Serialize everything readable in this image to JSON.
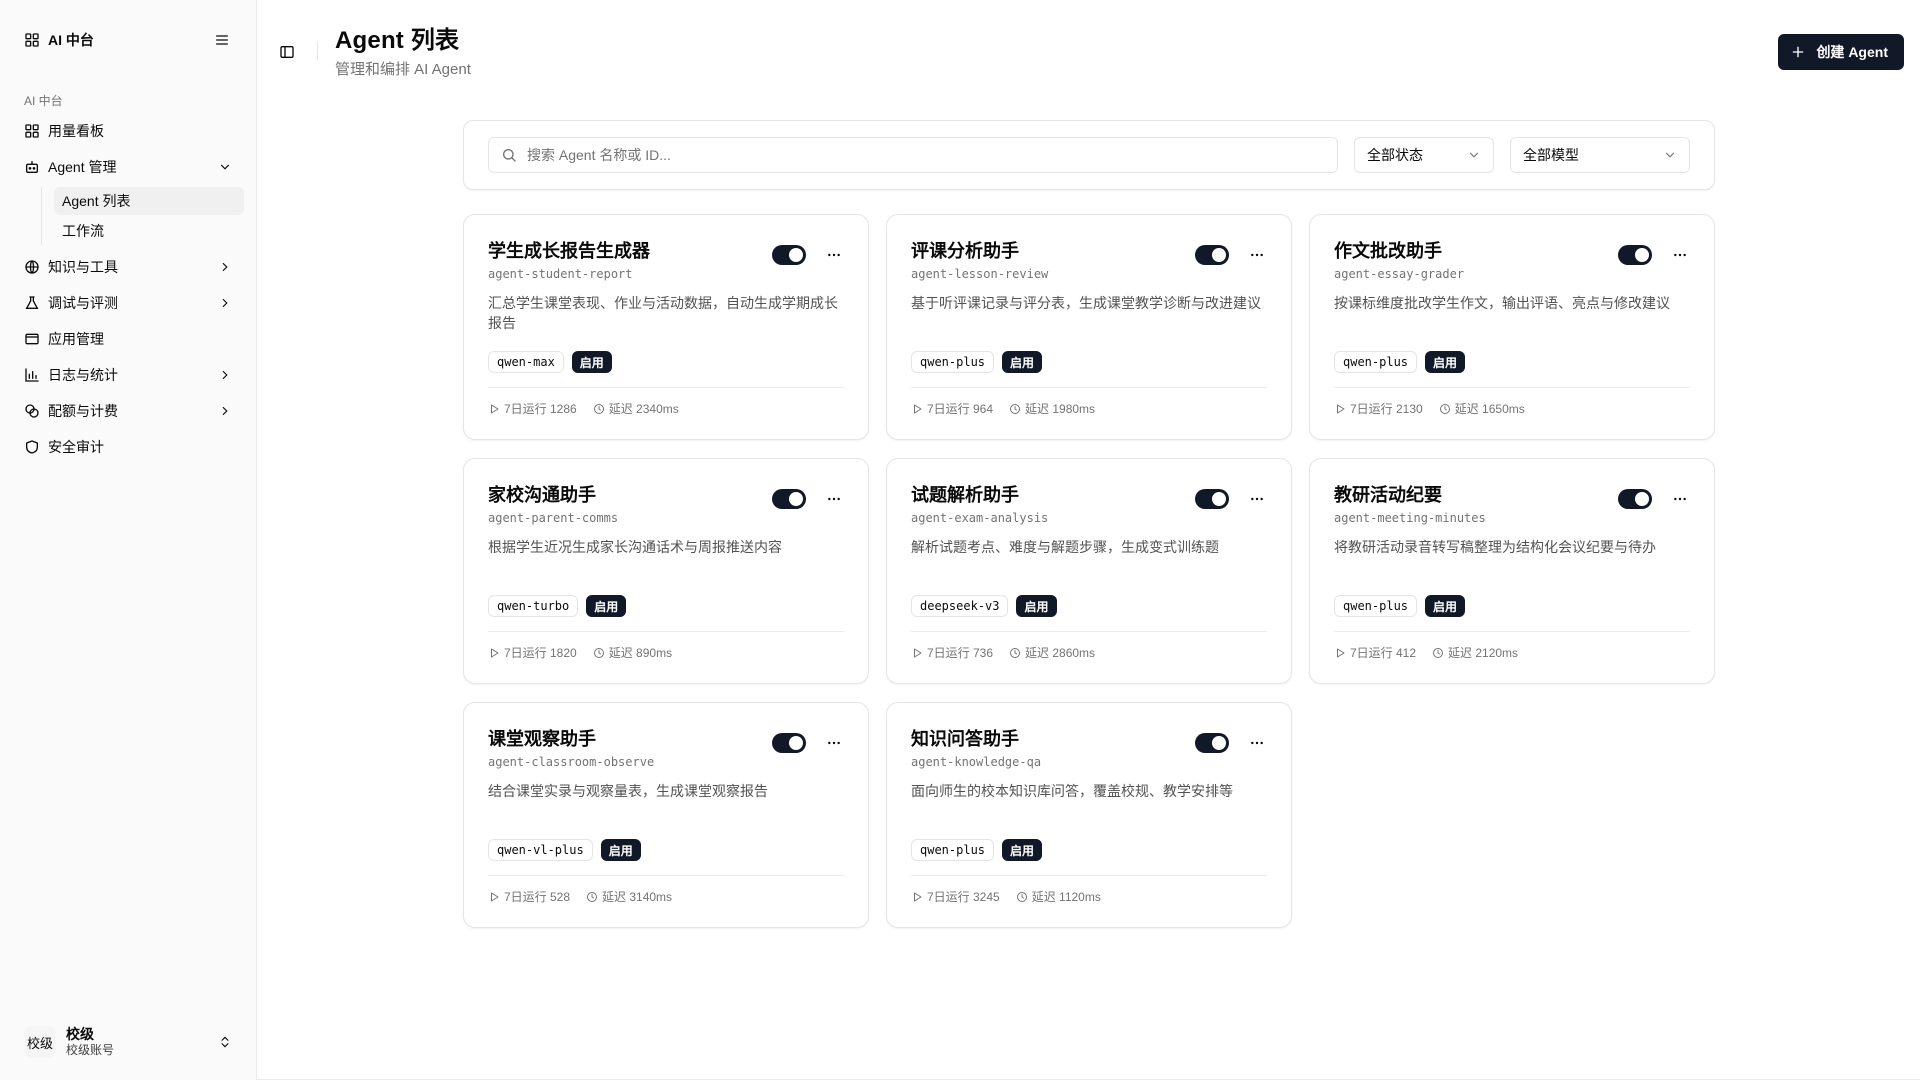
{
  "sidebar": {
    "brand": "AI 中台",
    "group_label": "AI 中台",
    "items": [
      {
        "label": "用量看板"
      },
      {
        "label": "Agent 管理"
      },
      {
        "label": "知识与工具"
      },
      {
        "label": "调试与评测"
      },
      {
        "label": "应用管理"
      },
      {
        "label": "日志与统计"
      },
      {
        "label": "配额与计费"
      },
      {
        "label": "安全审计"
      }
    ],
    "sub_items": [
      {
        "label": "Agent 列表"
      },
      {
        "label": "工作流"
      }
    ],
    "user": {
      "avatar": "校级",
      "name": "校级",
      "sub": "校级账号"
    }
  },
  "header": {
    "title": "Agent 列表",
    "subtitle": "管理和编排 AI Agent",
    "create_label": "创建 Agent"
  },
  "filters": {
    "search_placeholder": "搜索 Agent 名称或 ID...",
    "status": "全部状态",
    "model": "全部模型"
  },
  "agents": [
    {
      "name": "学生成长报告生成器",
      "id": "agent-student-report",
      "desc": "汇总学生课堂表现、作业与活动数据，自动生成学期成长报告",
      "model": "qwen-max",
      "status": "启用",
      "runs": "7日运行 1286",
      "latency": "延迟 2340ms"
    },
    {
      "name": "评课分析助手",
      "id": "agent-lesson-review",
      "desc": "基于听评课记录与评分表，生成课堂教学诊断与改进建议",
      "model": "qwen-plus",
      "status": "启用",
      "runs": "7日运行 964",
      "latency": "延迟 1980ms"
    },
    {
      "name": "作文批改助手",
      "id": "agent-essay-grader",
      "desc": "按课标维度批改学生作文，输出评语、亮点与修改建议",
      "model": "qwen-plus",
      "status": "启用",
      "runs": "7日运行 2130",
      "latency": "延迟 1650ms"
    },
    {
      "name": "家校沟通助手",
      "id": "agent-parent-comms",
      "desc": "根据学生近况生成家长沟通话术与周报推送内容",
      "model": "qwen-turbo",
      "status": "启用",
      "runs": "7日运行 1820",
      "latency": "延迟 890ms"
    },
    {
      "name": "试题解析助手",
      "id": "agent-exam-analysis",
      "desc": "解析试题考点、难度与解题步骤，生成变式训练题",
      "model": "deepseek-v3",
      "status": "启用",
      "runs": "7日运行 736",
      "latency": "延迟 2860ms"
    },
    {
      "name": "教研活动纪要",
      "id": "agent-meeting-minutes",
      "desc": "将教研活动录音转写稿整理为结构化会议纪要与待办",
      "model": "qwen-plus",
      "status": "启用",
      "runs": "7日运行 412",
      "latency": "延迟 2120ms"
    },
    {
      "name": "课堂观察助手",
      "id": "agent-classroom-observe",
      "desc": "结合课堂实录与观察量表，生成课堂观察报告",
      "model": "qwen-vl-plus",
      "status": "启用",
      "runs": "7日运行 528",
      "latency": "延迟 3140ms"
    },
    {
      "name": "知识问答助手",
      "id": "agent-knowledge-qa",
      "desc": "面向师生的校本知识库问答，覆盖校规、教学安排等",
      "model": "qwen-plus",
      "status": "启用",
      "runs": "7日运行 3245",
      "latency": "延迟 1120ms"
    }
  ],
  "colors": {
    "primary": "#111827",
    "muted": "#737373",
    "border": "#e5e5e5"
  }
}
